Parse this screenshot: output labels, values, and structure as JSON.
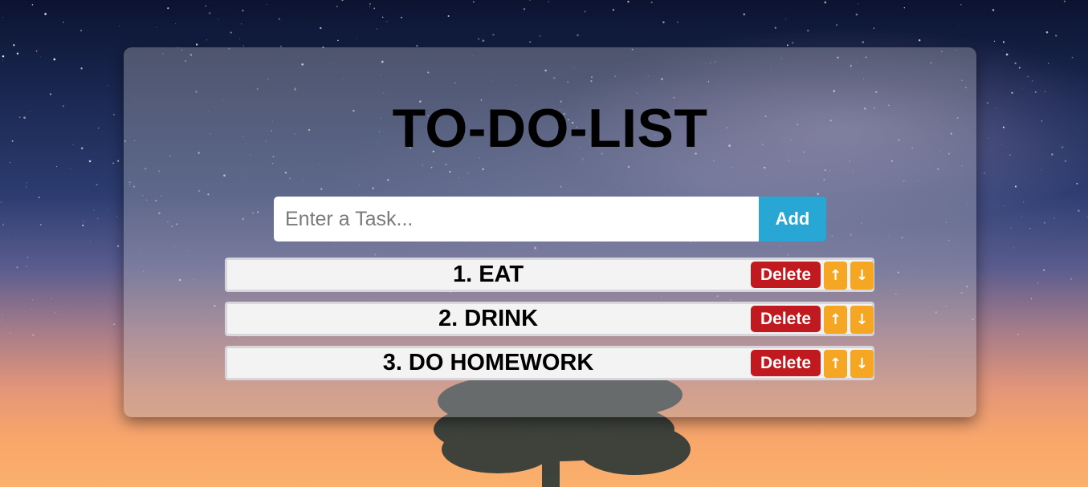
{
  "app": {
    "title": "TO-DO-LIST"
  },
  "input": {
    "placeholder": "Enter a Task...",
    "value": "",
    "add_label": "Add"
  },
  "tasks": [
    {
      "text": "1. EAT",
      "delete_label": "Delete",
      "up_label": "↑",
      "down_label": "↓"
    },
    {
      "text": "2. DRINK",
      "delete_label": "Delete",
      "up_label": "↑",
      "down_label": "↓"
    },
    {
      "text": "3. DO HOMEWORK",
      "delete_label": "Delete",
      "up_label": "↑",
      "down_label": "↓"
    }
  ],
  "colors": {
    "add_button": "#28a7d4",
    "delete_button": "#c0191f",
    "arrow_buttons": "#f5a623"
  }
}
